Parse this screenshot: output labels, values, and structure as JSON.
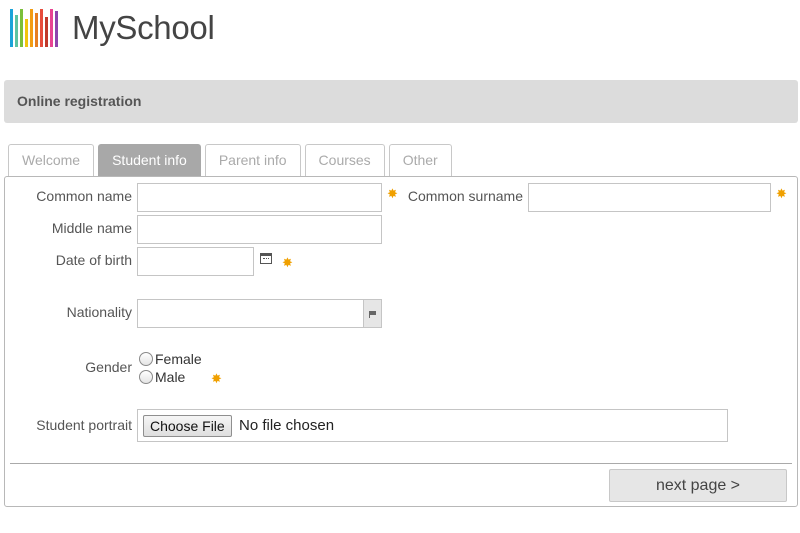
{
  "logo": {
    "text": "MySchool",
    "bar_colors": [
      "#1aa3d9",
      "#5cc3a1",
      "#7bbf3a",
      "#f1c40f",
      "#f39c12",
      "#e67e22",
      "#e74c3c",
      "#c0392b",
      "#e84393",
      "#8e44ad"
    ]
  },
  "header": {
    "title": "Online registration"
  },
  "tabs": [
    {
      "label": "Welcome",
      "active": false
    },
    {
      "label": "Student info",
      "active": true
    },
    {
      "label": "Parent info",
      "active": false
    },
    {
      "label": "Courses",
      "active": false
    },
    {
      "label": "Other",
      "active": false
    }
  ],
  "form": {
    "common_name": {
      "label": "Common name",
      "value": "",
      "required": true
    },
    "common_surname": {
      "label": "Common surname",
      "value": "",
      "required": true
    },
    "middle_name": {
      "label": "Middle name",
      "value": ""
    },
    "date_of_birth": {
      "label": "Date of birth",
      "value": "",
      "required": true
    },
    "nationality": {
      "label": "Nationality",
      "value": ""
    },
    "gender": {
      "label": "Gender",
      "options": [
        "Female",
        "Male"
      ],
      "selected": null,
      "required": true
    },
    "portrait": {
      "label": "Student portrait",
      "button_label": "Choose File",
      "status": "No file chosen"
    }
  },
  "required_marker": "✸",
  "next_button": {
    "label": "next page >"
  }
}
